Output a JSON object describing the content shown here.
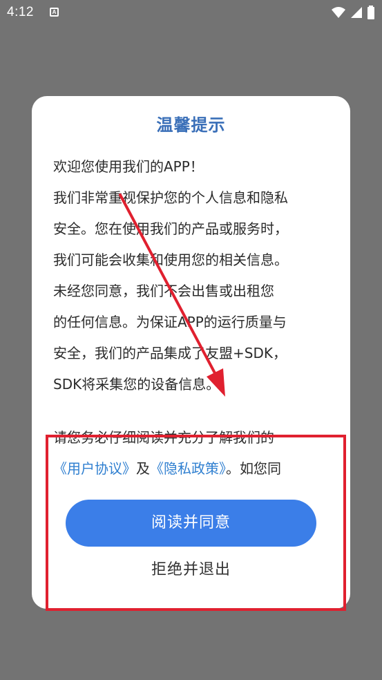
{
  "status_bar": {
    "time": "4:12",
    "notification_glyph": "A",
    "icons": [
      "wifi-icon",
      "signal-icon",
      "battery-icon"
    ]
  },
  "dialog": {
    "title": "温馨提示",
    "body_lines": [
      "欢迎您使用我们的APP！",
      "我们非常重视保护您的个人信息和隐私",
      "安全。您在使用我们的产品或服务时，",
      "我们可能会收集和使用您的相关信息。",
      "未经您同意，我们不会出售或出租您",
      "的任何信息。为保证APP的运行质量与",
      "安全，我们的产品集成了友盟+SDK，",
      "SDK将采集您的设备信息。"
    ],
    "para2_line1": "请您务必仔细阅读并充分了解我们的",
    "user_agreement_link": "《用户协议》",
    "and_text": "及",
    "privacy_policy_link": "《隐私政策》",
    "para2_tail": "。如您同",
    "agree_button": "阅读并同意",
    "refuse_button": "拒绝并退出"
  },
  "colors": {
    "title": "#3a6fb8",
    "link": "#2f7fd0",
    "primary_button": "#3b7ee8",
    "annotation": "#e0202f",
    "scrim": "#737373"
  }
}
